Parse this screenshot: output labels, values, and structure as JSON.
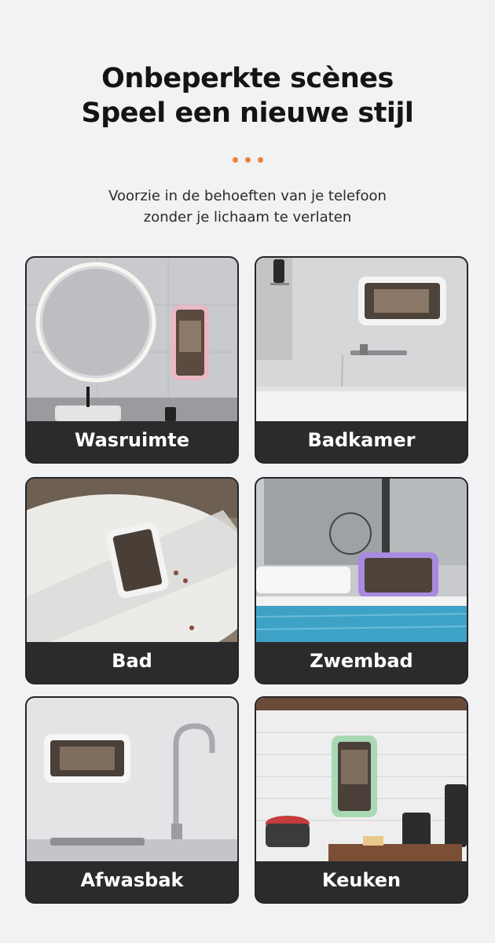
{
  "header": {
    "title_line1": "Onbeperkte scènes",
    "title_line2": "Speel een nieuwe stijl",
    "subtitle_line1": "Voorzie in de behoeften van je telefoon",
    "subtitle_line2": "zonder je lichaam te verlaten"
  },
  "accent_color": "#ee7f3e",
  "scenes": [
    {
      "label": "Wasruimte"
    },
    {
      "label": "Badkamer"
    },
    {
      "label": "Bad"
    },
    {
      "label": "Zwembad"
    },
    {
      "label": "Afwasbak"
    },
    {
      "label": "Keuken"
    }
  ]
}
